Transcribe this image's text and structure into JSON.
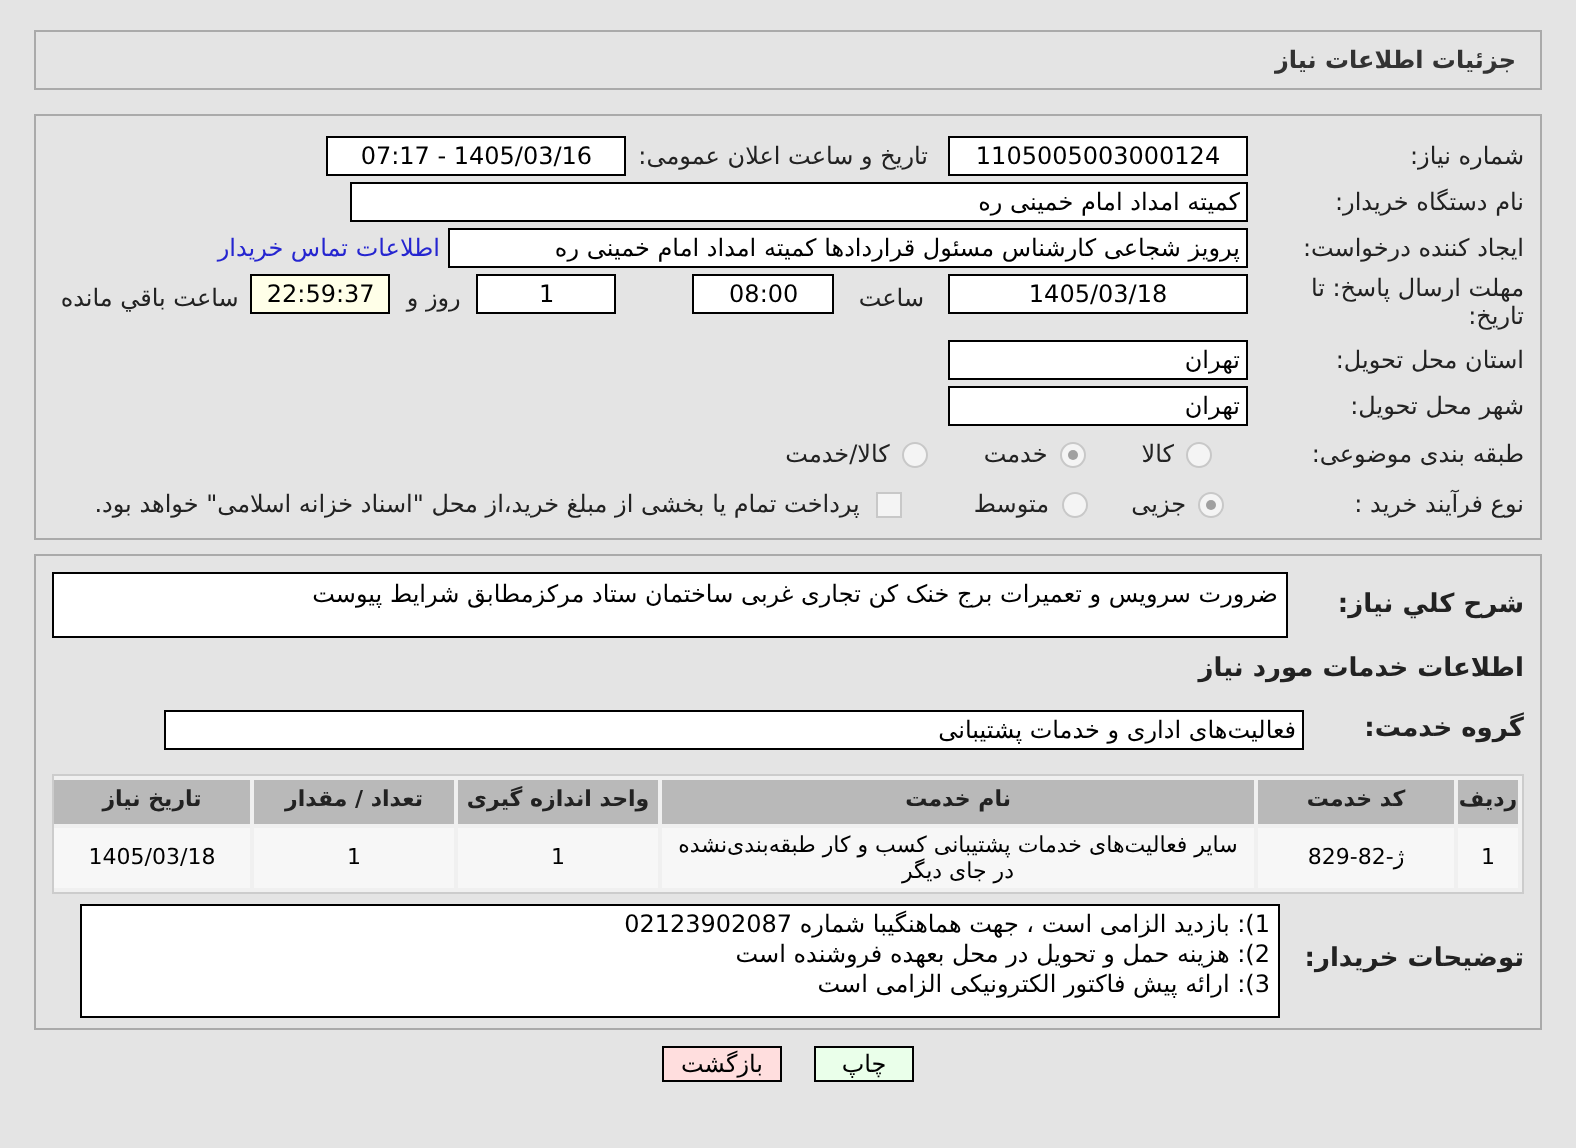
{
  "header": {
    "title": "جزئیات اطلاعات نیاز"
  },
  "need_number": {
    "label": "شماره نیاز:",
    "value": "1105005003000124"
  },
  "announce": {
    "label": "تاریخ و ساعت اعلان عمومی:",
    "value": "1405/03/16 - 07:17"
  },
  "buyer_org": {
    "label": "نام دستگاه خریدار:",
    "value": "کمیته امداد امام خمینی ره"
  },
  "requester": {
    "label": "ایجاد کننده درخواست:",
    "value": "پرویز شجاعی کارشناس مسئول قراردادها کمیته امداد امام خمینی ره",
    "link": "اطلاعات تماس خریدار"
  },
  "deadline": {
    "label": "مهلت ارسال پاسخ: تا تاریخ:",
    "date": "1405/03/18",
    "time_label": "ساعت",
    "time": "08:00",
    "days": "1",
    "days_label": "روز و",
    "remaining": "22:59:37",
    "remaining_label": "ساعت باقي مانده"
  },
  "province": {
    "label": "استان محل تحویل:",
    "value": "تهران"
  },
  "city": {
    "label": "شهر محل تحویل:",
    "value": "تهران"
  },
  "category": {
    "label": "طبقه بندی موضوعی:",
    "options": [
      {
        "label": "کالا",
        "selected": false
      },
      {
        "label": "خدمت",
        "selected": true
      },
      {
        "label": "کالا/خدمت",
        "selected": false
      }
    ]
  },
  "purchase_type": {
    "label": "نوع فرآیند خرید :",
    "options": [
      {
        "label": "جزیی",
        "selected": true
      },
      {
        "label": "متوسط",
        "selected": false
      }
    ],
    "payment": {
      "label": "پرداخت تمام یا بخشی از مبلغ خرید،از محل \"اسناد خزانه اسلامی\" خواهد بود.",
      "checked": false
    }
  },
  "summary": {
    "label": "شرح کلي نیاز:",
    "value": "ضرورت سرویس و تعمیرات برج خنک کن تجاری غربی ساختمان ستاد مرکزمطابق شرایط پیوست"
  },
  "services_title": "اطلاعات خدمات مورد نیاز",
  "service_group": {
    "label": "گروه خدمت:",
    "value": "فعالیت‌های اداری و خدمات پشتیبانی"
  },
  "table": {
    "columns": [
      "ردیف",
      "کد خدمت",
      "نام خدمت",
      "واحد اندازه گیری",
      "تعداد / مقدار",
      "تاریخ نیاز"
    ],
    "rows": [
      [
        "1",
        "ژ-82-829",
        "سایر فعالیت‌های خدمات پشتیبانی کسب و کار طبقه‌بندی‌نشده در جای دیگر",
        "1",
        "1",
        "1405/03/18"
      ]
    ]
  },
  "buyer_notes": {
    "label": "توضیحات خریدار:",
    "lines": [
      "1): بازدید الزامی است ، جهت هماهنگیبا شماره 02123902087",
      "2): هزینه حمل و تحویل در محل بعهده فروشنده است",
      "3): ارائه پیش فاکتور الکترونیکی الزامی است"
    ]
  },
  "buttons": [
    {
      "label": "چاپ",
      "kind": "print"
    },
    {
      "label": "بازگشت",
      "kind": "back"
    }
  ]
}
